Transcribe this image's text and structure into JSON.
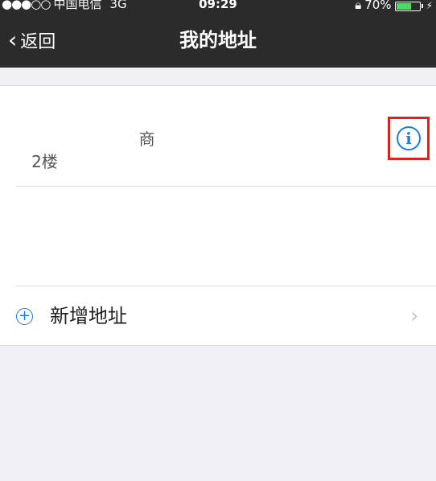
{
  "status_bar": {
    "signal": "●●●○○",
    "carrier": "中国电信",
    "network": "3G",
    "time": "09:29",
    "battery_percent": "70%",
    "battery_level": 0.7
  },
  "nav": {
    "back_label": "返回",
    "title": "我的地址"
  },
  "address": {
    "name": " ",
    "line1": "                        商",
    "line2": "   2楼"
  },
  "add_row": {
    "label": "新增地址"
  },
  "colors": {
    "accent": "#1a7ee3",
    "highlight": "#e0201b",
    "bar": "#2b2b2b",
    "battery": "#4cd964"
  }
}
